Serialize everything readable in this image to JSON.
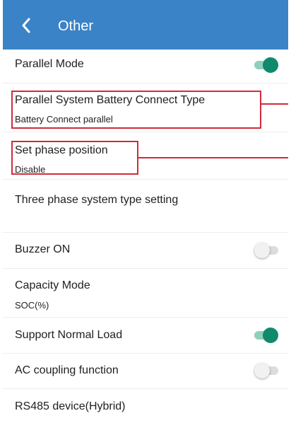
{
  "header": {
    "title": "Other",
    "back_icon": "chevron-left-icon",
    "color": "#3b83c7"
  },
  "accent": "#0f8a6a",
  "highlight_color": "#d12b3a",
  "settings": [
    {
      "label": "Parallel Mode",
      "toggle": true
    },
    {
      "label": "Parallel System Battery Connect Type",
      "value": "Battery Connect parallel"
    },
    {
      "label": "Set phase position",
      "value": "Disable"
    },
    {
      "label": "Three phase system type setting"
    },
    {
      "label": "Buzzer ON",
      "toggle": false
    },
    {
      "label": "Capacity Mode",
      "value": "SOC(%)"
    },
    {
      "label": "Support Normal Load",
      "toggle": true
    },
    {
      "label": "AC coupling function",
      "toggle": false
    },
    {
      "label": "RS485 device(Hybrid)"
    }
  ]
}
